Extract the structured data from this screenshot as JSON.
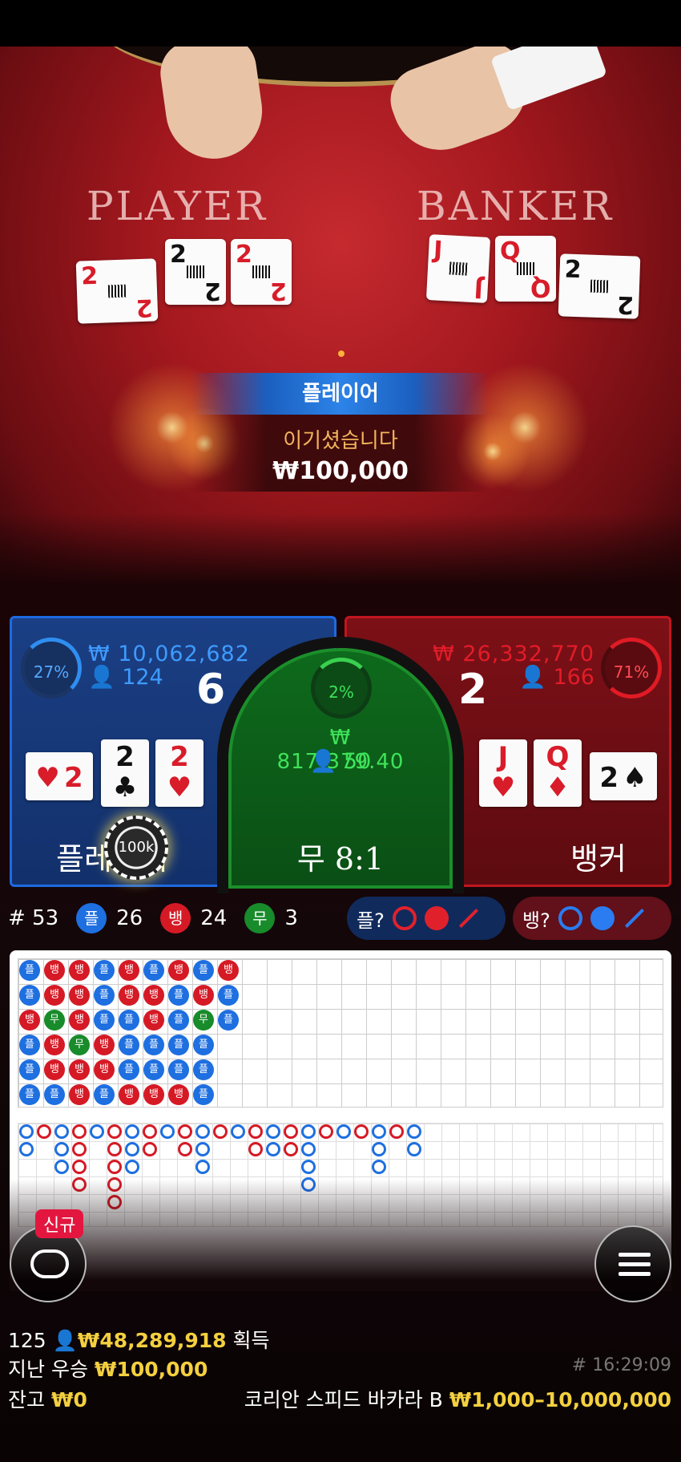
{
  "video": {
    "player_label": "PLAYER",
    "banker_label": "BANKER",
    "player_cards": [
      {
        "rank": "2",
        "suit": "♥",
        "color": "red"
      },
      {
        "rank": "2",
        "suit": "♣",
        "color": "black"
      },
      {
        "rank": "2",
        "suit": "♥",
        "color": "red"
      }
    ],
    "banker_cards": [
      {
        "rank": "J",
        "suit": "♥",
        "color": "red"
      },
      {
        "rank": "Q",
        "suit": "♦",
        "color": "red"
      },
      {
        "rank": "2",
        "suit": "♠",
        "color": "black"
      }
    ],
    "result_banner": "플레이어",
    "win_message": "이기셨습니다",
    "win_amount": "₩100,000"
  },
  "bets": {
    "player": {
      "percent": "27%",
      "amount": "₩ 10,062,682",
      "count": "124",
      "score": "6",
      "label": "플레이어",
      "cards": [
        {
          "rank": "2",
          "suit": "♥"
        },
        {
          "rank": "2",
          "suit": "♣"
        },
        {
          "rank": "2",
          "suit": "♥"
        }
      ],
      "chip": "100k"
    },
    "tie": {
      "percent": "2%",
      "amount": "₩ 817,379.40",
      "count": "50",
      "label": "무 8:1"
    },
    "banker": {
      "percent": "71%",
      "amount": "₩ 26,332,770",
      "count": "166",
      "score": "2",
      "label": "뱅커",
      "cards": [
        {
          "rank": "J",
          "suit": "♥"
        },
        {
          "rank": "Q",
          "suit": "♦"
        },
        {
          "rank": "2",
          "suit": "♠"
        }
      ]
    }
  },
  "stats": {
    "round": "# 53",
    "player_badge": "플",
    "player_count": "26",
    "banker_badge": "뱅",
    "banker_count": "24",
    "tie_badge": "무",
    "tie_count": "3",
    "ask_player": "플?",
    "ask_banker": "뱅?"
  },
  "bead_road": [
    [
      "플",
      "플",
      "뱅",
      "플",
      "플",
      "플"
    ],
    [
      "뱅",
      "뱅",
      "무",
      "뱅",
      "뱅",
      "플"
    ],
    [
      "뱅",
      "뱅",
      "뱅",
      "무",
      "뱅",
      "뱅"
    ],
    [
      "플",
      "플",
      "플",
      "뱅",
      "뱅",
      "플"
    ],
    [
      "뱅",
      "뱅",
      "플",
      "플",
      "플",
      "뱅"
    ],
    [
      "플",
      "뱅",
      "뱅",
      "플",
      "플",
      "뱅"
    ],
    [
      "뱅",
      "플",
      "플",
      "플",
      "플",
      "뱅"
    ],
    [
      "플",
      "뱅",
      "무",
      "플",
      "플",
      "플"
    ],
    [
      "뱅",
      "플",
      "플",
      "",
      "",
      ""
    ]
  ],
  "colors": {
    "player": "#1e6fe0",
    "banker": "#d51a25",
    "tie": "#188b2a",
    "gold": "#f4d03f"
  },
  "buttons": {
    "new_badge": "신규",
    "chat_icon": "chat-bubble-icon",
    "menu_icon": "hamburger-icon"
  },
  "footer": {
    "players": "125",
    "total_won": "₩48,289,918",
    "won_label": "획득",
    "last_win_label": "지난 우승",
    "last_win": "₩100,000",
    "balance_label": "잔고",
    "balance": "₩0",
    "time": "# 16:29:09",
    "table_name": "코리안 스피드 바카라 B",
    "limits": "₩1,000–10,000,000"
  }
}
